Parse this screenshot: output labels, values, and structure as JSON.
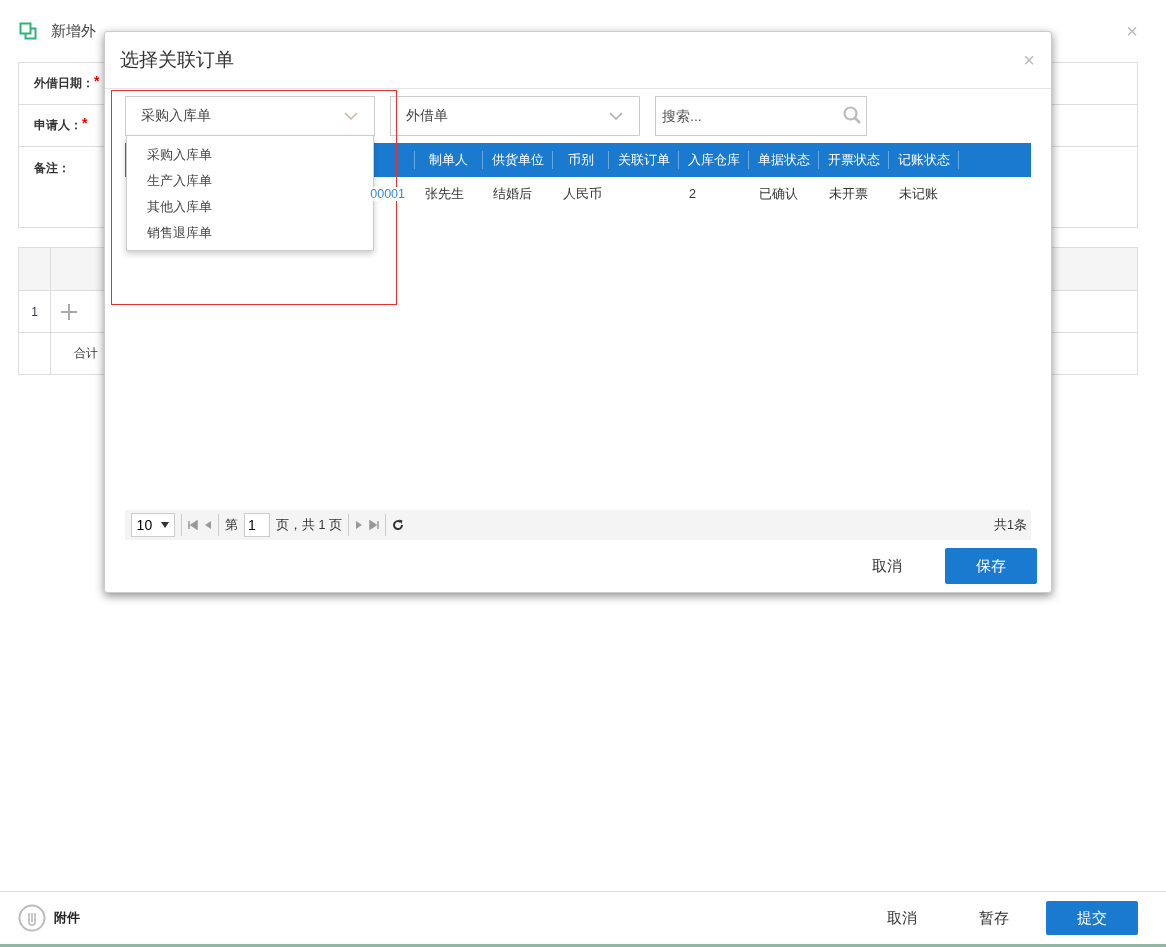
{
  "page": {
    "title": "新增外",
    "close": "×",
    "form": [
      {
        "label": "外借日期：",
        "required_mark": "*"
      },
      {
        "label": "申请人：",
        "required_mark": "*"
      },
      {
        "label": "备注：",
        "multiline": true
      }
    ],
    "grid": {
      "rows": [
        {
          "index": "1"
        }
      ],
      "total_label": "合计"
    },
    "footer": {
      "attachment": "附件",
      "buttons": [
        {
          "label": "取消",
          "primary": false
        },
        {
          "label": "暂存",
          "primary": false
        },
        {
          "label": "提交",
          "primary": true
        }
      ]
    }
  },
  "dialog": {
    "title": "选择关联订单",
    "close": "×",
    "filters": [
      {
        "kind": "select",
        "value": "采购入库单",
        "expanded": true,
        "options": [
          "采购入库单",
          "生产入库单",
          "其他入库单",
          "销售退库单"
        ]
      },
      {
        "kind": "select",
        "value": "外借单",
        "expanded": false
      },
      {
        "kind": "search",
        "placeholder": "搜索..."
      }
    ],
    "table": {
      "columns": [
        {
          "cell": "00001",
          "link": true
        },
        {
          "label": "制单人",
          "cell": "张先生"
        },
        {
          "label": "供货单位",
          "cell": "结婚后"
        },
        {
          "label": "币别",
          "cell": "人民币"
        },
        {
          "label": "关联订单"
        },
        {
          "label": "入库仓库",
          "cell": "2"
        },
        {
          "label": "单据状态",
          "cell": "已确认"
        },
        {
          "label": "开票状态",
          "cell": "未开票"
        },
        {
          "label": "记账状态",
          "cell": "未记账"
        }
      ]
    },
    "pager": {
      "page_size": "10",
      "page_prefix": "第",
      "page": "1",
      "page_suffix": "页，共 1 页",
      "total": "共1条"
    },
    "buttons": [
      {
        "label": "取消",
        "primary": false
      },
      {
        "label": "保存",
        "primary": true
      }
    ]
  }
}
